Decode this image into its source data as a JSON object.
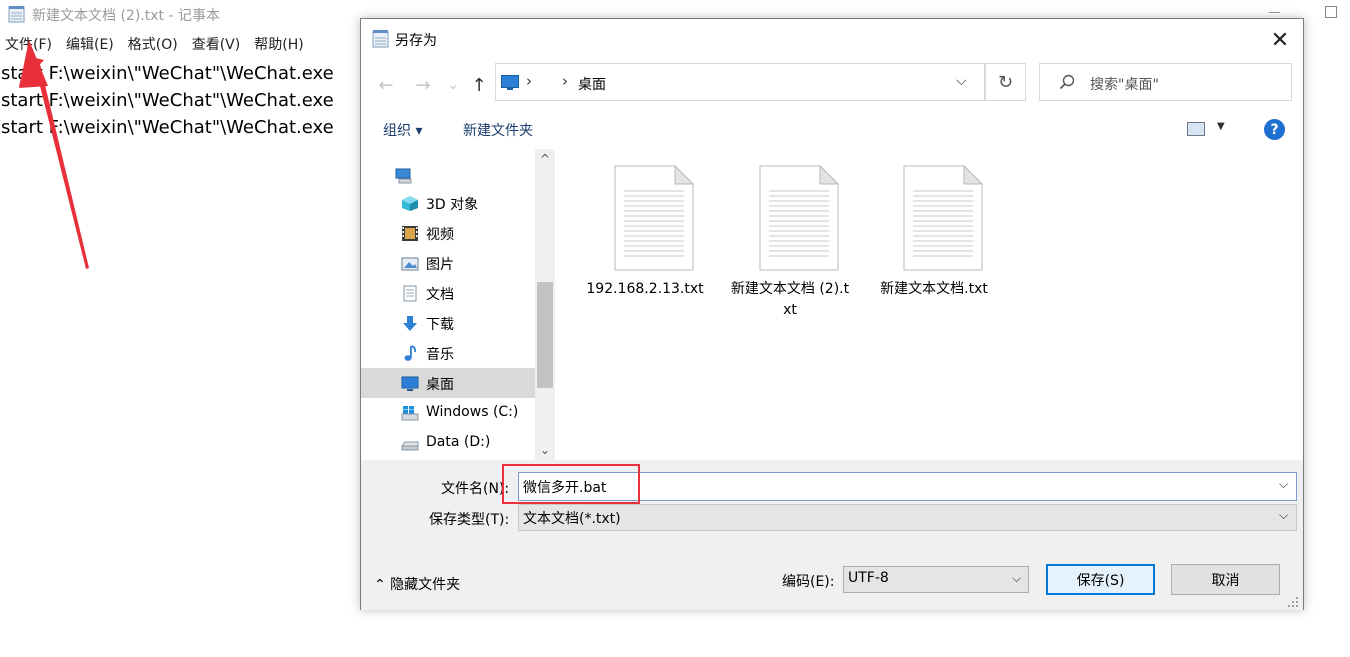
{
  "notepad": {
    "title": "新建文本文档 (2).txt - 记事本",
    "menu": [
      "文件(F)",
      "编辑(E)",
      "格式(O)",
      "查看(V)",
      "帮助(H)"
    ],
    "lines": [
      "start F:\\weixin\\\"WeChat\"\\WeChat.exe",
      "start F:\\weixin\\\"WeChat\"\\WeChat.exe",
      "start F:\\weixin\\\"WeChat\"\\WeChat.exe"
    ]
  },
  "dialog": {
    "title": "另存为",
    "close_glyph": "✕",
    "address": {
      "current": "桌面",
      "sep1": "›",
      "sep2": "›",
      "dropdown_glyph": "⌵"
    },
    "nav_buttons": {
      "back": "←",
      "forward": "→",
      "history": "⌄",
      "up": "↑"
    },
    "refresh_glyph": "↻",
    "search_placeholder": "搜索\"桌面\"",
    "toolbar": {
      "organize": "组织 ▾",
      "new_folder": "新建文件夹",
      "help": "?"
    },
    "nav_items": [
      {
        "label": "",
        "icon": "computer-icon"
      },
      {
        "label": "3D 对象",
        "icon": "3d-objects-icon"
      },
      {
        "label": "视频",
        "icon": "video-icon"
      },
      {
        "label": "图片",
        "icon": "pictures-icon"
      },
      {
        "label": "文档",
        "icon": "documents-icon"
      },
      {
        "label": "下载",
        "icon": "downloads-icon"
      },
      {
        "label": "音乐",
        "icon": "music-icon"
      },
      {
        "label": "桌面",
        "icon": "desktop-icon",
        "selected": true
      },
      {
        "label": "Windows (C:)",
        "icon": "windows-drive-icon"
      },
      {
        "label": "Data (D:)",
        "icon": "drive-icon"
      }
    ],
    "scroll": {
      "up": "^",
      "down": "⌄"
    },
    "files": [
      {
        "name": "192.168.2.13.txt"
      },
      {
        "name": "新建文本文档 (2).txt"
      },
      {
        "name": "新建文本文档.txt"
      }
    ],
    "filename_label": "文件名(N):",
    "filename_value": "微信多开.bat",
    "filetype_label": "保存类型(T):",
    "filetype_value": "文本文档(*.txt)",
    "hide_folders": "⌃ 隐藏文件夹",
    "encoding_label": "编码(E):",
    "encoding_value": "UTF-8",
    "save_button": "保存(S)",
    "cancel_button": "取消",
    "caret": "⌵"
  },
  "colors": {
    "accent": "#0078d7",
    "annotation": "#e8303a",
    "selection": "#d9d9d9",
    "panel": "#f0f0f0"
  }
}
